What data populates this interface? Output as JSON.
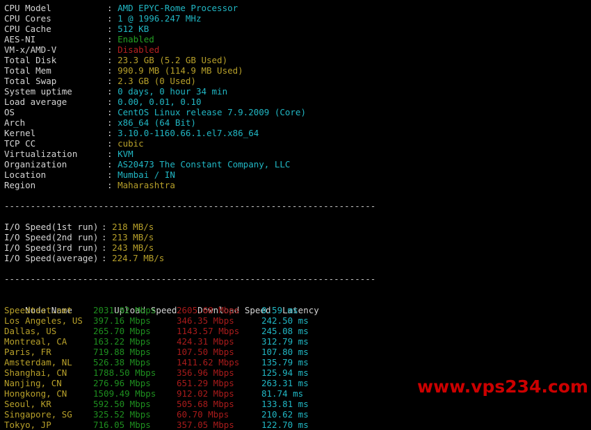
{
  "terminal": {
    "background_color": "#000000",
    "label_color": "#d5d5d5",
    "cyan_color": "#21b7c4",
    "yellow_color": "#b7a02a",
    "green_color": "#23a024",
    "red_color": "#b52020",
    "separator": "-----------------------------------------------------------------------"
  },
  "sysinfo": {
    "rows": [
      {
        "label": "CPU Model",
        "colon": ":",
        "value": "AMD EPYC-Rome Processor",
        "color": "v-cyan"
      },
      {
        "label": "CPU Cores",
        "colon": ":",
        "value": "1 @ 1996.247 MHz",
        "color": "v-cyan"
      },
      {
        "label": "CPU Cache",
        "colon": ":",
        "value": "512 KB",
        "color": "v-cyan"
      },
      {
        "label": "AES-NI",
        "colon": ":",
        "value": "Enabled",
        "color": "v-green"
      },
      {
        "label": "VM-x/AMD-V",
        "colon": ":",
        "value": "Disabled",
        "color": "v-red"
      },
      {
        "label": "Total Disk",
        "colon": ":",
        "value": "23.3 GB (5.2 GB Used)",
        "color": "v-yellow"
      },
      {
        "label": "Total Mem",
        "colon": ":",
        "value": "990.9 MB (114.9 MB Used)",
        "color": "v-yellow"
      },
      {
        "label": "Total Swap",
        "colon": ":",
        "value": "2.3 GB (0 Used)",
        "color": "v-yellow"
      },
      {
        "label": "System uptime",
        "colon": ":",
        "value": "0 days, 0 hour 34 min",
        "color": "v-cyan"
      },
      {
        "label": "Load average",
        "colon": ":",
        "value": "0.00, 0.01, 0.10",
        "color": "v-cyan"
      },
      {
        "label": "OS",
        "colon": ":",
        "value": "CentOS Linux release 7.9.2009 (Core)",
        "color": "v-cyan"
      },
      {
        "label": "Arch",
        "colon": ":",
        "value": "x86_64 (64 Bit)",
        "color": "v-cyan"
      },
      {
        "label": "Kernel",
        "colon": ":",
        "value": "3.10.0-1160.66.1.el7.x86_64",
        "color": "v-cyan"
      },
      {
        "label": "TCP CC",
        "colon": ":",
        "value": "cubic",
        "color": "v-yellow"
      },
      {
        "label": "Virtualization",
        "colon": ":",
        "value": "KVM",
        "color": "v-cyan"
      },
      {
        "label": "Organization",
        "colon": ":",
        "value": "AS20473 The Constant Company, LLC",
        "color": "v-cyan"
      },
      {
        "label": "Location",
        "colon": ":",
        "value": "Mumbai / IN",
        "color": "v-cyan"
      },
      {
        "label": "Region",
        "colon": ":",
        "value": "Maharashtra",
        "color": "v-yellow"
      }
    ]
  },
  "iotest": {
    "rows": [
      {
        "label": "I/O Speed(1st run)",
        "colon": ":",
        "value": "218 MB/s",
        "color": "v-yellow"
      },
      {
        "label": "I/O Speed(2nd run)",
        "colon": ":",
        "value": "213 MB/s",
        "color": "v-yellow"
      },
      {
        "label": "I/O Speed(3rd run)",
        "colon": ":",
        "value": "243 MB/s",
        "color": "v-yellow"
      },
      {
        "label": "I/O Speed(average)",
        "colon": ":",
        "value": "224.7 MB/s",
        "color": "v-yellow"
      }
    ]
  },
  "speedtest": {
    "headers": {
      "node": "Node Name",
      "upload": "Upload Speed",
      "download": "Download Speed",
      "latency": "Latency"
    },
    "rows": [
      {
        "node": "Speedtest.net",
        "upload": "2031.92 Mbps",
        "download": "2605.68 Mbps",
        "latency": "0.59 ms"
      },
      {
        "node": "Los Angeles, US",
        "upload": "397.16 Mbps",
        "download": "346.35 Mbps",
        "latency": "242.50 ms"
      },
      {
        "node": "Dallas, US",
        "upload": "265.70 Mbps",
        "download": "1143.57 Mbps",
        "latency": "245.08 ms"
      },
      {
        "node": "Montreal, CA",
        "upload": "163.22 Mbps",
        "download": "424.31 Mbps",
        "latency": "312.79 ms"
      },
      {
        "node": "Paris, FR",
        "upload": "719.88 Mbps",
        "download": "107.50 Mbps",
        "latency": "107.80 ms"
      },
      {
        "node": "Amsterdam, NL",
        "upload": "526.38 Mbps",
        "download": "1411.62 Mbps",
        "latency": "135.79 ms"
      },
      {
        "node": "Shanghai, CN",
        "upload": "1788.50 Mbps",
        "download": "356.96 Mbps",
        "latency": "125.94 ms"
      },
      {
        "node": "Nanjing, CN",
        "upload": "276.96 Mbps",
        "download": "651.29 Mbps",
        "latency": "263.31 ms"
      },
      {
        "node": "Hongkong, CN",
        "upload": "1509.49 Mbps",
        "download": "912.02 Mbps",
        "latency": "81.74 ms"
      },
      {
        "node": "Seoul, KR",
        "upload": "592.50 Mbps",
        "download": "505.68 Mbps",
        "latency": "133.81 ms"
      },
      {
        "node": "Singapore, SG",
        "upload": "325.52 Mbps",
        "download": "60.70 Mbps",
        "latency": "210.62 ms"
      },
      {
        "node": "Tokyo, JP",
        "upload": "716.05 Mbps",
        "download": "357.05 Mbps",
        "latency": "122.70 ms"
      }
    ]
  },
  "watermark": {
    "text": "www.vps234.com",
    "color": "#cc0000"
  }
}
